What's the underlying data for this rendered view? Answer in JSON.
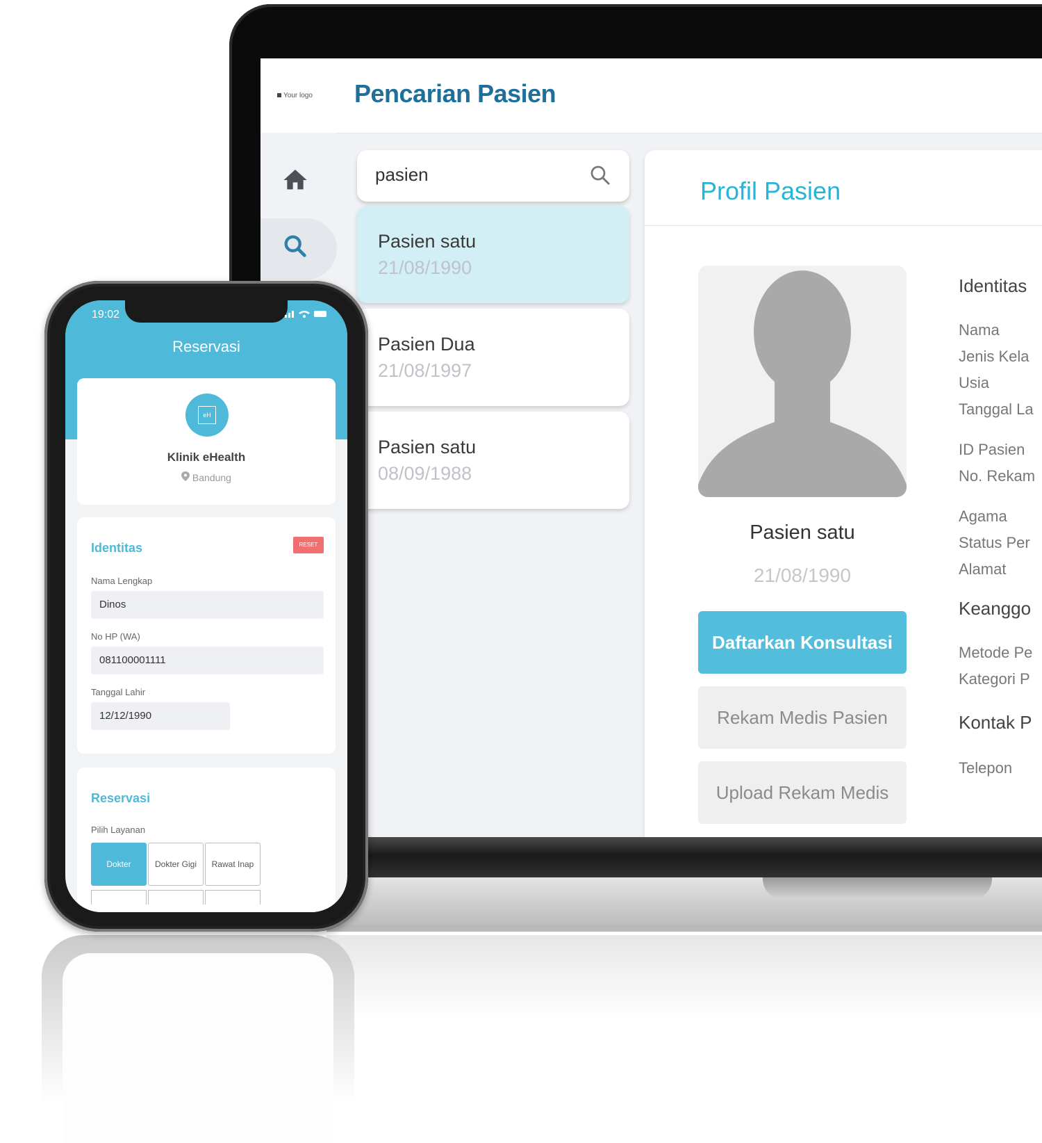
{
  "laptop": {
    "logo_text": "Your logo",
    "page_title": "Pencarian Pasien",
    "nav": [
      {
        "icon": "home-icon"
      },
      {
        "icon": "search-icon",
        "active": true
      }
    ],
    "search": {
      "value": "pasien",
      "icon": "search-icon"
    },
    "patients": [
      {
        "name": "Pasien satu",
        "dob": "21/08/1990",
        "active": true
      },
      {
        "name": "Pasien Dua",
        "dob": "21/08/1997",
        "active": false
      },
      {
        "name": "Pasien satu",
        "dob": "08/09/1988",
        "active": false
      }
    ],
    "profile": {
      "title": "Profil Pasien",
      "name": "Pasien satu",
      "dob": "21/08/1990",
      "buttons": {
        "primary": "Daftarkan Konsultasi",
        "records": "Rekam Medis Pasien",
        "upload": "Upload Rekam Medis"
      },
      "info_sections": {
        "identitas": "Identitas",
        "keanggotaan": "Keanggo",
        "kontak": "Kontak P"
      },
      "info_labels": {
        "nama": "Nama",
        "jenis_kelamin": "Jenis Kela",
        "usia": "Usia",
        "tanggal_lahir": "Tanggal La",
        "id_pasien": "ID Pasien",
        "no_rekam": "No. Rekam",
        "agama": "Agama",
        "status": "Status Per",
        "alamat": "Alamat",
        "metode": "Metode Pe",
        "kategori": "Kategori P",
        "telepon": "Telepon"
      }
    }
  },
  "phone": {
    "status_time": "19:02",
    "title": "Reservasi",
    "clinic": {
      "logo_text": "eH",
      "name": "Klinik eHealth",
      "location": "Bandung"
    },
    "identity": {
      "title": "Identitas",
      "reset_label": "RESET",
      "fields": {
        "name_label": "Nama Lengkap",
        "name_value": "Dinos",
        "phone_label": "No HP (WA)",
        "phone_value": "081100001111",
        "dob_label": "Tanggal Lahir",
        "dob_value": "12/12/1990"
      }
    },
    "reservation": {
      "title": "Reservasi",
      "service_label": "Pilih Layanan",
      "services": [
        "Dokter",
        "Dokter Gigi",
        "Rawat Inap"
      ],
      "selected": "Dokter"
    }
  },
  "colors": {
    "brand_blue": "#1f6f9a",
    "accent_cyan": "#25b5d6",
    "phone_blue": "#4eb9d8",
    "reset_red": "#f07070"
  }
}
